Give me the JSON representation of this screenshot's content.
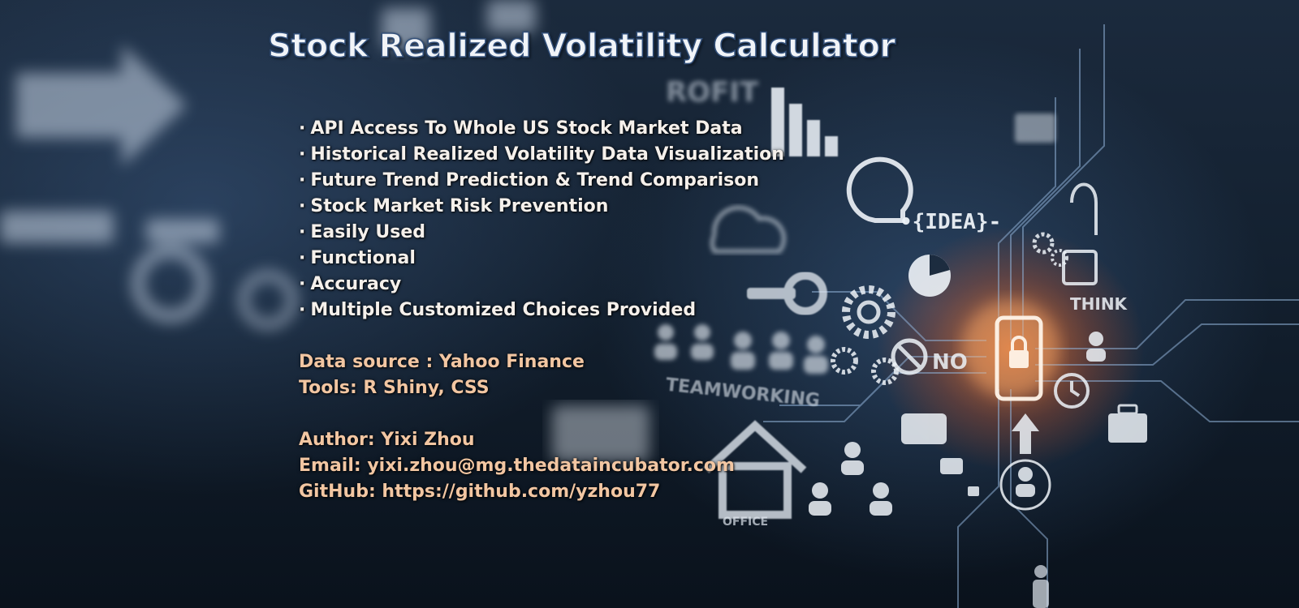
{
  "title": "Stock Realized Volatility Calculator",
  "features": [
    "API Access To Whole US Stock Market Data",
    "Historical Realized Volatility Data Visualization",
    "Future Trend Prediction & Trend Comparison",
    "Stock Market Risk Prevention",
    "Easily Used",
    "Functional",
    "Accuracy",
    "Multiple Customized Choices Provided"
  ],
  "bullet": "·",
  "info": {
    "data_source": "Data source : Yahoo Finance",
    "tools": "Tools: R Shiny, CSS"
  },
  "author": {
    "name": "Author: Yixi Zhou",
    "email_label": "Email: ",
    "email": "yixi.zhou@mg.thedataincubator.com",
    "github_label": "GitHub: ",
    "github": "https://github.com/yzhou77"
  },
  "background_words": {
    "idea": "•{IDEA}-",
    "think": "THINK",
    "teamworking": "TEAMWORKING",
    "profit": "ROFIT",
    "no": "NO",
    "office": "OFFICE"
  },
  "colors": {
    "title_fill": "#f1f4f8",
    "title_outline": "#33507a",
    "feature_text": "#f5f0eb",
    "info_text": "#f2c6a2",
    "glow": "#ff7a28"
  }
}
